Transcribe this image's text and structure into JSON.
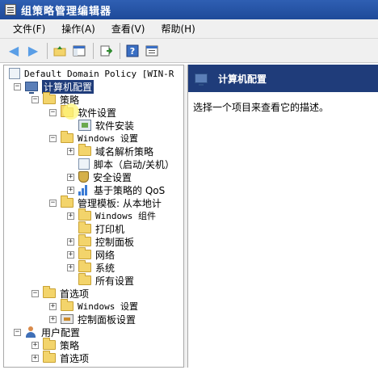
{
  "window": {
    "title": "组策略管理编辑器"
  },
  "menu": [
    "文件(F)",
    "操作(A)",
    "查看(V)",
    "帮助(H)"
  ],
  "tree": {
    "root": "Default Domain Policy [WIN-R",
    "computer_config": "计算机配置",
    "policies": "策略",
    "software_settings": "软件设置",
    "software_install": "软件安装",
    "windows_settings": "Windows 设置",
    "name_resolution": "域名解析策略",
    "scripts": "脚本（启动/关机）",
    "security_settings": "安全设置",
    "qos": "基于策略的 QoS",
    "admin_templates": "管理模板: 从本地计",
    "windows_components": "Windows 组件",
    "printers": "打印机",
    "control_panel": "控制面板",
    "network": "网络",
    "system": "系统",
    "all_settings": "所有设置",
    "preferences": "首选项",
    "pref_windows_settings": "Windows 设置",
    "pref_control_panel": "控制面板设置",
    "user_config": "用户配置",
    "user_policies": "策略",
    "user_preferences": "首选项"
  },
  "right": {
    "header": "计算机配置",
    "description": "选择一个项目来查看它的描述。"
  }
}
